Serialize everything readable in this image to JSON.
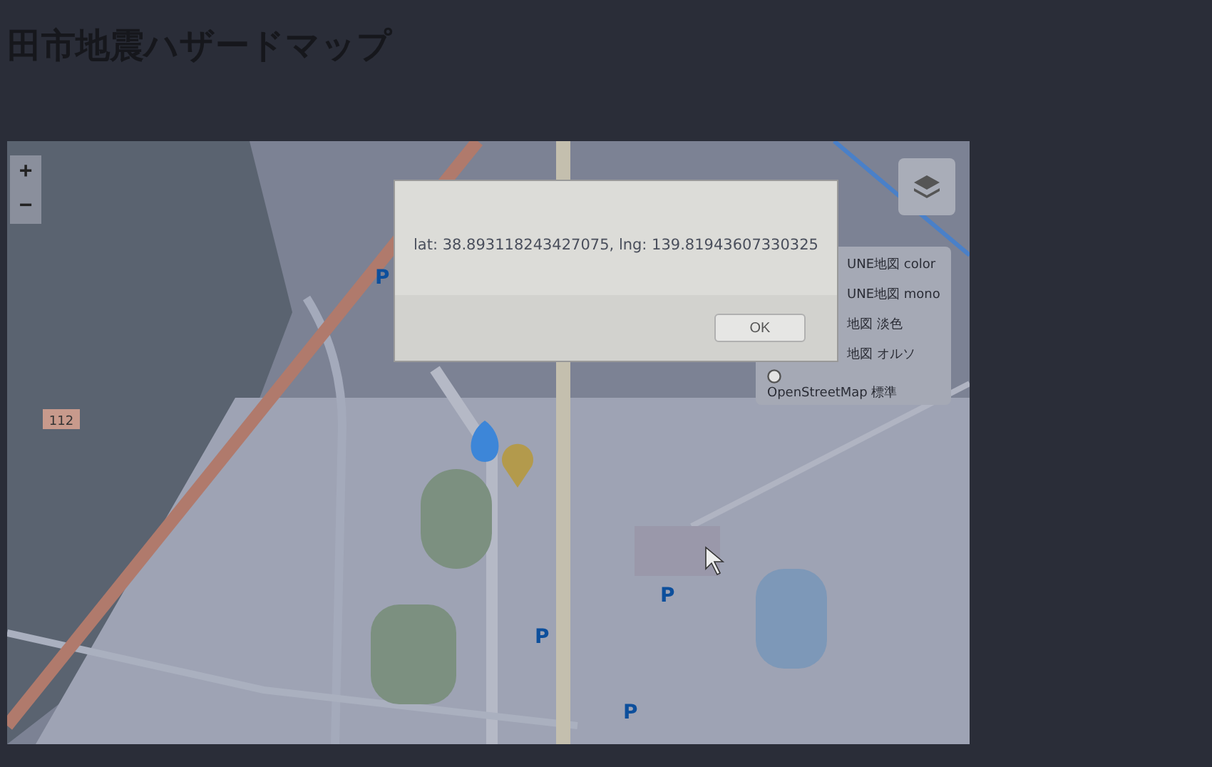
{
  "page": {
    "title": "田市地震ハザードマップ"
  },
  "map": {
    "zoom_in": "+",
    "zoom_out": "−",
    "road_shield": "112",
    "parking_signs": [
      "P",
      "P",
      "P",
      "P"
    ]
  },
  "layer_list": [
    {
      "kind": "hidden-radio",
      "label": "UNE地図 color"
    },
    {
      "kind": "hidden-radio",
      "label": "UNE地図 mono"
    },
    {
      "kind": "hidden-radio",
      "label": "地図 淡色"
    },
    {
      "kind": "hidden-radio",
      "label": "地図 オルソ"
    },
    {
      "kind": "radio",
      "label": "OpenStreetMap 標準",
      "selected": false
    }
  ],
  "dialog": {
    "message": "lat: 38.893118243427075, lng: 139.81943607330325",
    "button": "OK"
  }
}
